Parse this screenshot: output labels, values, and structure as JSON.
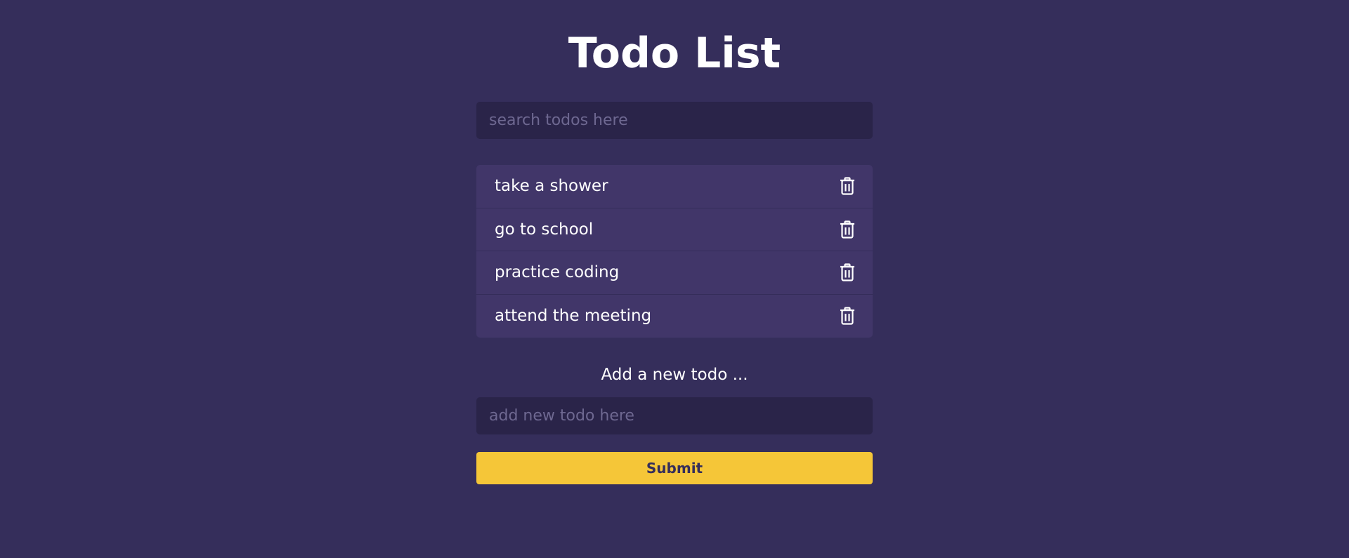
{
  "header": {
    "title": "Todo List"
  },
  "search": {
    "placeholder": "search todos here",
    "value": ""
  },
  "todos": [
    {
      "text": "take a shower",
      "icon": "trash-icon"
    },
    {
      "text": "go to school",
      "icon": "trash-icon"
    },
    {
      "text": "practice coding",
      "icon": "trash-icon"
    },
    {
      "text": "attend the meeting",
      "icon": "trash-icon"
    }
  ],
  "add_form": {
    "label": "Add a new todo ...",
    "placeholder": "add new todo here",
    "value": "",
    "submit_label": "Submit"
  },
  "colors": {
    "background": "#352e5b",
    "input_background": "#2a2449",
    "list_background": "#413669",
    "button_accent": "#f5c638",
    "text": "#ffffff"
  }
}
